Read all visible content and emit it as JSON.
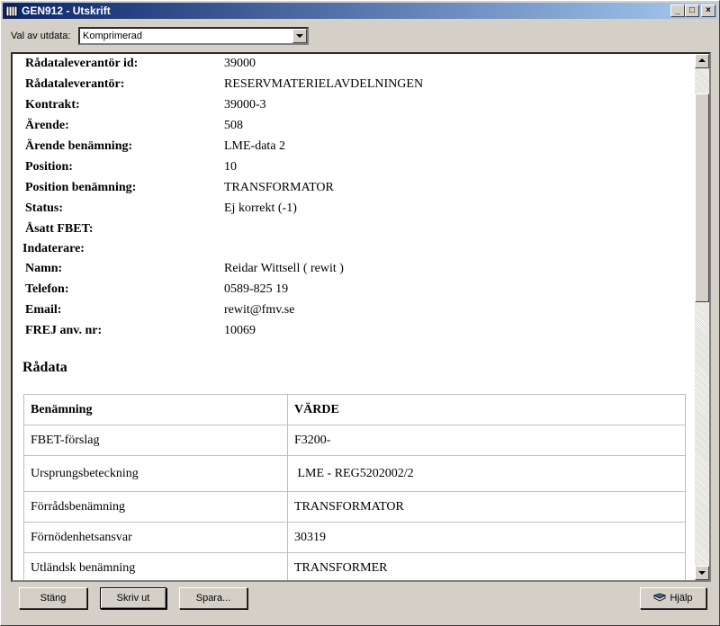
{
  "window": {
    "title": "GEN912 - Utskrift"
  },
  "output_select": {
    "label": "Val av utdata:",
    "value": "Komprimerad"
  },
  "fields": [
    {
      "label": "Rådataleverantör id:",
      "value": "39000"
    },
    {
      "label": "Rådataleverantör:",
      "value": "RESERVMATERIELAVDELNINGEN"
    },
    {
      "label": "Kontrakt:",
      "value": "39000-3"
    },
    {
      "label": "Ärende:",
      "value": "508"
    },
    {
      "label": "Ärende benämning:",
      "value": "LME-data 2"
    },
    {
      "label": "Position:",
      "value": "10"
    },
    {
      "label": "Position benämning:",
      "value": "TRANSFORMATOR"
    },
    {
      "label": "Status:",
      "value": "Ej korrekt (-1)"
    },
    {
      "label": "Åsatt FBET:",
      "value": ""
    }
  ],
  "indaterare": {
    "heading": "Indaterare:",
    "fields": [
      {
        "label": "Namn:",
        "value": "Reidar Wittsell ( rewit )"
      },
      {
        "label": "Telefon:",
        "value": "0589-825 19"
      },
      {
        "label": "Email:",
        "value": "rewit@fmv.se"
      },
      {
        "label": "FREJ anv. nr:",
        "value": "10069"
      }
    ]
  },
  "radata": {
    "heading": "Rådata",
    "columns": [
      "Benämning",
      "VÄRDE"
    ],
    "rows": [
      [
        "FBET-förslag",
        "F3200-"
      ],
      [
        "Ursprungsbeteckning",
        " LME - REG5202002/2"
      ],
      [
        "Förrådsbenämning",
        "TRANSFORMATOR"
      ],
      [
        "Förnödenhetsansvar",
        "30319"
      ],
      [
        "Utländsk benämning",
        "TRANSFORMER"
      ]
    ]
  },
  "buttons": {
    "close": "Stäng",
    "print": "Skriv ut",
    "save": "Spara...",
    "help": "Hjälp"
  }
}
